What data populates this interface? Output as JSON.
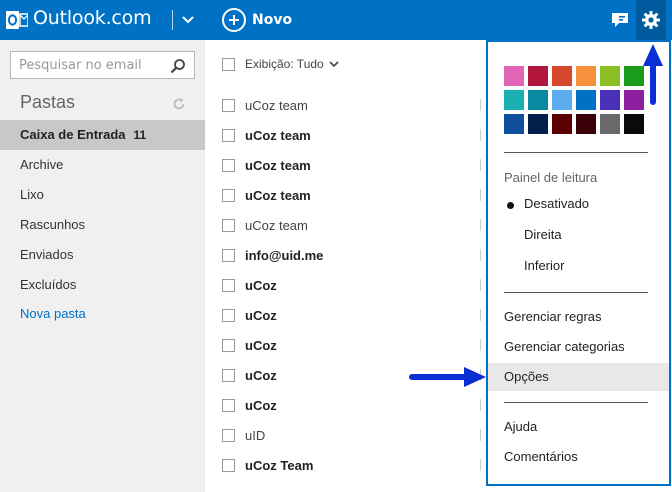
{
  "topbar": {
    "app_title": "Outlook.com",
    "new_label": "Novo",
    "bg_color": "#0072c6",
    "icons": [
      "outlook-logo-icon",
      "chevron-down-icon",
      "plus-circle-icon",
      "chat-icon",
      "gear-icon"
    ]
  },
  "sidebar": {
    "search_placeholder": "Pesquisar no email",
    "folders_title": "Pastas",
    "folders": [
      {
        "label": "Caixa de Entrada",
        "count": "11"
      },
      {
        "label": "Archive"
      },
      {
        "label": "Lixo"
      },
      {
        "label": "Rascunhos"
      },
      {
        "label": "Enviados"
      },
      {
        "label": "Excluídos"
      }
    ],
    "new_folder_label": "Nova pasta"
  },
  "list": {
    "view_label": "Exibição: Tudo",
    "messages": [
      {
        "sender": "uCoz team",
        "unread": false
      },
      {
        "sender": "uCoz team",
        "unread": true
      },
      {
        "sender": "uCoz team",
        "unread": true
      },
      {
        "sender": "uCoz team",
        "unread": true
      },
      {
        "sender": "uCoz team",
        "unread": false
      },
      {
        "sender": "info@uid.me",
        "unread": true
      },
      {
        "sender": "uCoz",
        "unread": true
      },
      {
        "sender": "uCoz",
        "unread": true
      },
      {
        "sender": "uCoz",
        "unread": true
      },
      {
        "sender": "uCoz",
        "unread": true
      },
      {
        "sender": "uCoz",
        "unread": true
      },
      {
        "sender": "uID",
        "unread": false
      },
      {
        "sender": "uCoz Team",
        "unread": true
      }
    ]
  },
  "settings_menu": {
    "theme_colors": [
      "#e066b5",
      "#b3163d",
      "#d9472b",
      "#f7913d",
      "#8cbf26",
      "#1a9b1a",
      "#18b0b0",
      "#0a8aa0",
      "#5aaef0",
      "#0072c6",
      "#4a2fb8",
      "#8c1fa0",
      "#0e4f9c",
      "#001f4a",
      "#5a0000",
      "#3a0008",
      "#6a6a6a",
      "#0a0a0a"
    ],
    "reading_pane_title": "Painel de leitura",
    "reading_pane_options": [
      "Desativado",
      "Direita",
      "Inferior"
    ],
    "reading_pane_selected": "Desativado",
    "manage_rules": "Gerenciar regras",
    "manage_categories": "Gerenciar categorias",
    "options": "Opções",
    "help": "Ajuda",
    "feedback": "Comentários"
  },
  "annotation_color": "#0a2fd4"
}
